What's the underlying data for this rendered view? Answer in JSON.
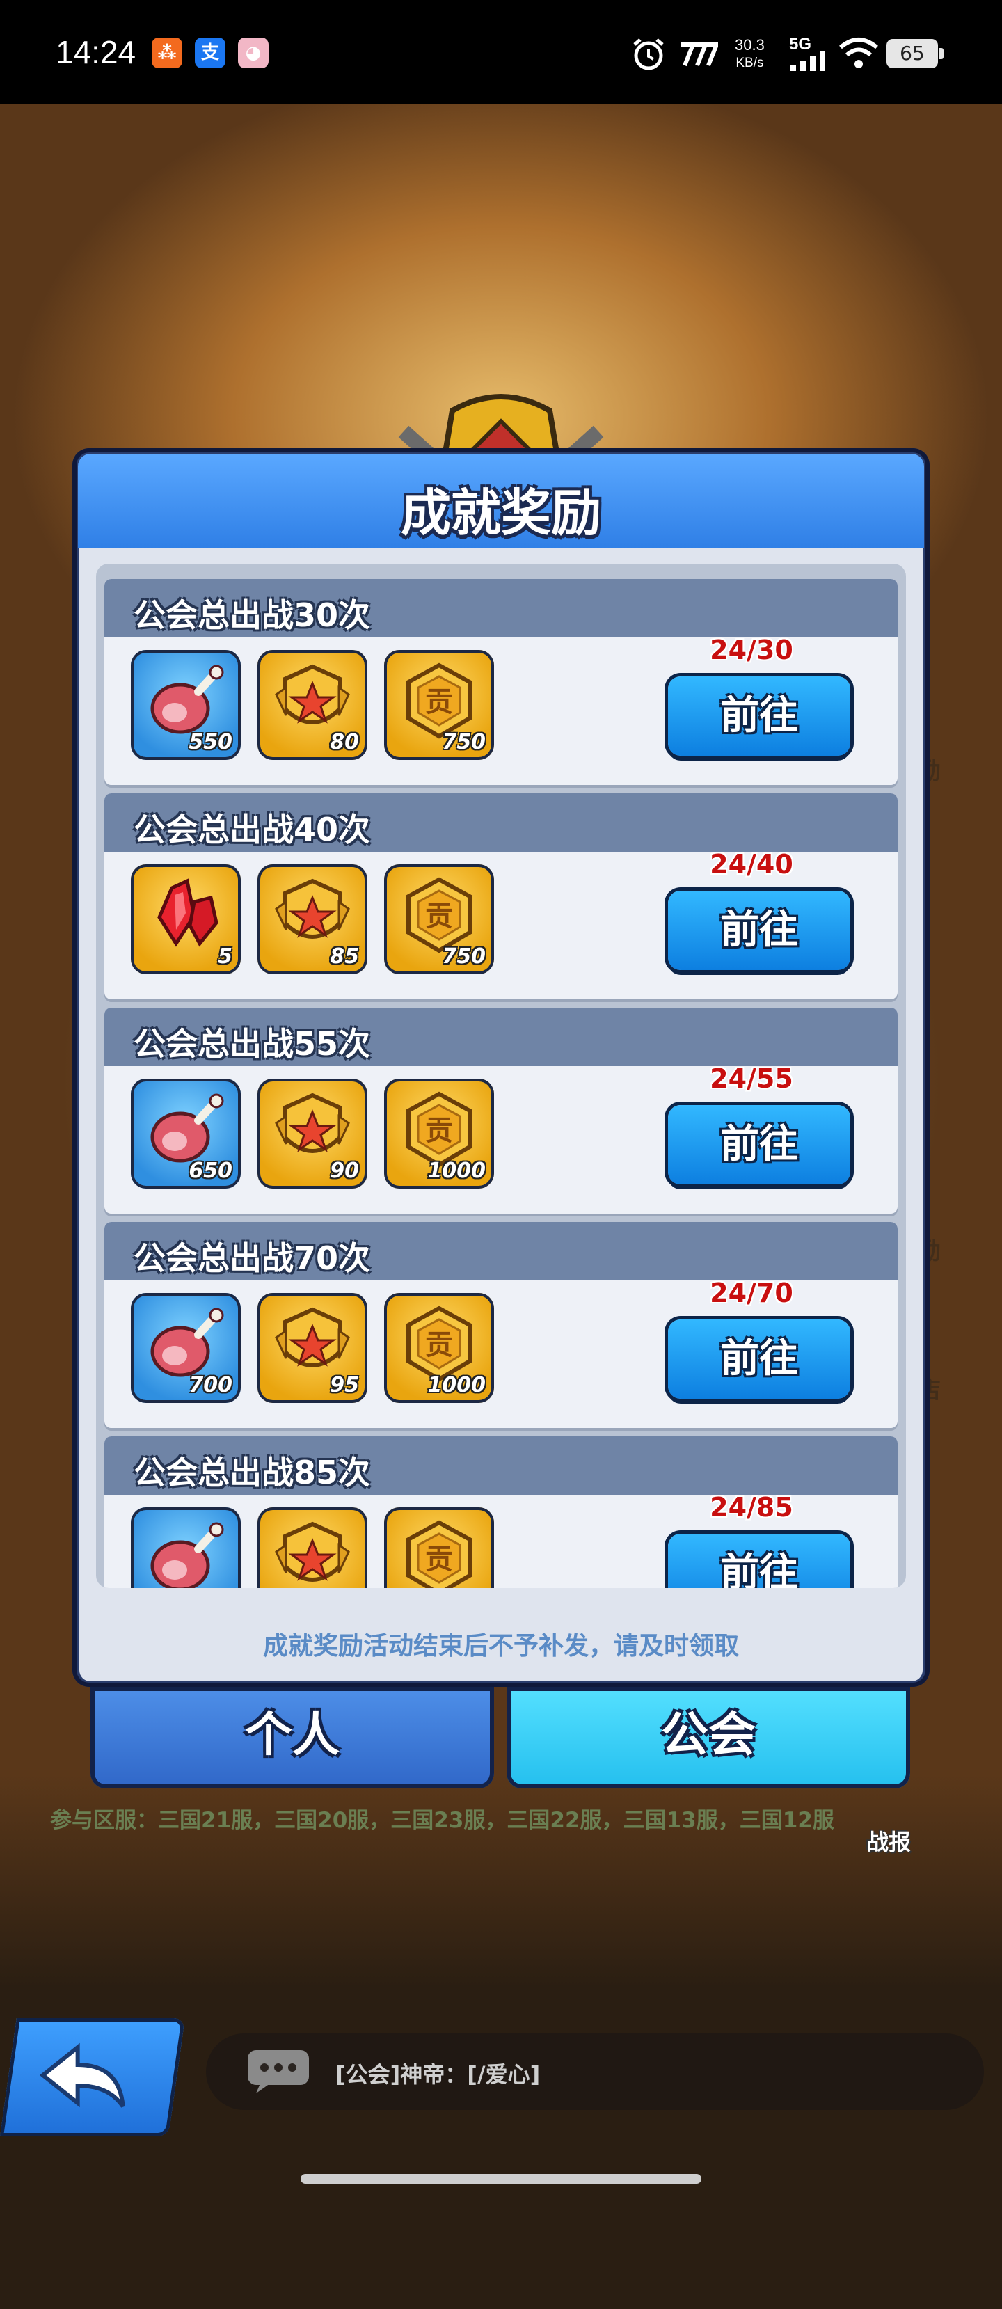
{
  "status_bar": {
    "time": "14:24",
    "net_speed_value": "30.3",
    "net_speed_unit": "KB/s",
    "network": "5G",
    "battery": "65",
    "icons": [
      "app-red-icon",
      "alipay-icon",
      "game-app-icon",
      "alarm-icon",
      "carrier-icon",
      "signal-icon",
      "wifi-icon",
      "battery-icon"
    ]
  },
  "dialog": {
    "title": "成就奖励",
    "notice": "成就奖励活动结束后不予补发，请及时领取",
    "cards": [
      {
        "title": "公会总出战30次",
        "progress": "24/30",
        "button": "前往",
        "rewards": [
          {
            "icon": "meat-icon",
            "count": "550"
          },
          {
            "icon": "star-badge-icon",
            "count": "80"
          },
          {
            "icon": "contribution-coin-icon",
            "count": "750"
          }
        ]
      },
      {
        "title": "公会总出战40次",
        "progress": "24/40",
        "button": "前往",
        "rewards": [
          {
            "icon": "red-crystal-icon",
            "count": "5"
          },
          {
            "icon": "star-badge-icon",
            "count": "85"
          },
          {
            "icon": "contribution-coin-icon",
            "count": "750"
          }
        ]
      },
      {
        "title": "公会总出战55次",
        "progress": "24/55",
        "button": "前往",
        "rewards": [
          {
            "icon": "meat-icon",
            "count": "650"
          },
          {
            "icon": "star-badge-icon",
            "count": "90"
          },
          {
            "icon": "contribution-coin-icon",
            "count": "1000"
          }
        ]
      },
      {
        "title": "公会总出战70次",
        "progress": "24/70",
        "button": "前往",
        "rewards": [
          {
            "icon": "meat-icon",
            "count": "700"
          },
          {
            "icon": "star-badge-icon",
            "count": "95"
          },
          {
            "icon": "contribution-coin-icon",
            "count": "1000"
          }
        ]
      },
      {
        "title": "公会总出战85次",
        "progress": "24/85",
        "button": "前往",
        "rewards": [
          {
            "icon": "meat-icon",
            "count": ""
          },
          {
            "icon": "star-badge-icon",
            "count": ""
          },
          {
            "icon": "contribution-coin-icon",
            "count": ""
          }
        ]
      }
    ]
  },
  "tabs": {
    "personal": "个人",
    "guild": "公会",
    "active": "guild"
  },
  "servers_text": "参与区服：三国21服，三国20服，三国23服，三国22服，三国13服，三国12服",
  "side_labels": {
    "a": "励",
    "b": "励",
    "c": "店",
    "report": "战报"
  },
  "chat": {
    "message": "[公会]神帝：[/爱心]"
  }
}
